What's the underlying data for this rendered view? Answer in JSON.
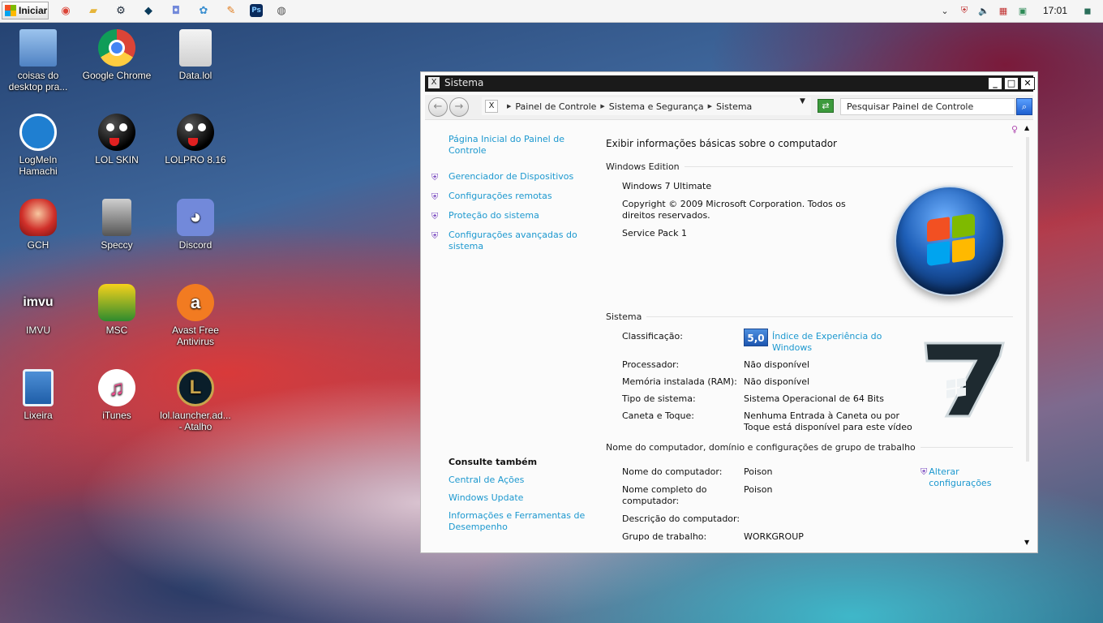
{
  "taskbar": {
    "start_label": "Iniciar",
    "pinned": [
      {
        "name": "chrome-icon",
        "glyph": "◉",
        "color": "#db4437"
      },
      {
        "name": "folder-icon",
        "glyph": "▰",
        "color": "#e6b53a"
      },
      {
        "name": "steam-icon",
        "glyph": "⚙",
        "color": "#1b2838"
      },
      {
        "name": "league-icon",
        "glyph": "◆",
        "color": "#0a3a5a"
      },
      {
        "name": "discord-icon",
        "glyph": "◘",
        "color": "#7289da"
      },
      {
        "name": "gallery-icon",
        "glyph": "✿",
        "color": "#3a8fd0"
      },
      {
        "name": "feather-icon",
        "glyph": "✎",
        "color": "#e07a1a"
      },
      {
        "name": "photoshop-icon",
        "glyph": "Ps",
        "color": "#0a2b5c"
      },
      {
        "name": "camera-icon",
        "glyph": "◍",
        "color": "#555555"
      }
    ],
    "clock": "17:01"
  },
  "desktop": {
    "icons": [
      {
        "label": "coisas do desktop pra...",
        "icon": "folder-icon",
        "color": "#5b8fd0"
      },
      {
        "label": "Google Chrome",
        "icon": "chrome-icon",
        "color": "#db4437"
      },
      {
        "label": "Data.lol",
        "icon": "file-icon",
        "color": "#e2e2e2"
      },
      {
        "label": "LogMeIn Hamachi",
        "icon": "hamachi-icon",
        "color": "#1f7fd1"
      },
      {
        "label": "LOL SKIN",
        "icon": "smiley-icon",
        "color": "#111111"
      },
      {
        "label": "LOLPRO 8.16",
        "icon": "smiley-icon",
        "color": "#111111"
      },
      {
        "label": "GCH",
        "icon": "anime-icon",
        "color": "#d0302a"
      },
      {
        "label": "Speccy",
        "icon": "speccy-icon",
        "color": "#777777"
      },
      {
        "label": "Discord",
        "icon": "discord-icon",
        "color": "#7289da"
      },
      {
        "label": "IMVU",
        "icon": "imvu-icon",
        "color": "#222222"
      },
      {
        "label": "MSC",
        "icon": "msc-icon",
        "color": "#2e8b2e"
      },
      {
        "label": "Avast Free Antivirus",
        "icon": "avast-icon",
        "color": "#f27b21"
      },
      {
        "label": "Lixeira",
        "icon": "recycle-bin-icon",
        "color": "#2c6fb8"
      },
      {
        "label": "iTunes",
        "icon": "itunes-icon",
        "color": "#e94b8a"
      },
      {
        "label": "lol.launcher.ad... - Atalho",
        "icon": "league-icon",
        "color": "#c8a44c"
      }
    ]
  },
  "window": {
    "title": "Sistema",
    "breadcrumb": [
      "Painel de Controle",
      "Sistema e Segurança",
      "Sistema"
    ],
    "search_placeholder": "Pesquisar Painel de Controle",
    "leftnav": {
      "home": "Página Inicial do Painel de Controle",
      "links": [
        "Gerenciador de Dispositivos",
        "Configurações remotas",
        "Proteção do sistema",
        "Configurações avançadas do sistema"
      ],
      "see_also_title": "Consulte também",
      "see_also": [
        "Central de Ações",
        "Windows Update",
        "Informações e Ferramentas de Desempenho"
      ]
    },
    "main": {
      "heading": "Exibir informações básicas sobre o computador",
      "edition_section": "Windows Edition",
      "edition": "Windows 7 Ultimate",
      "copyright": "Copyright © 2009 Microsoft Corporation. Todos os direitos reservados.",
      "service_pack": "Service Pack 1",
      "system_section": "Sistema",
      "rating_label": "Classificação:",
      "rating_score": "5,0",
      "rating_link": "Índice de Experiência do Windows",
      "processor_label": "Processador:",
      "processor_value": "Não disponível",
      "ram_label": "Memória instalada (RAM):",
      "ram_value": "Não disponível",
      "type_label": "Tipo de sistema:",
      "type_value": "Sistema Operacional de 64 Bits",
      "pen_label": "Caneta e Toque:",
      "pen_value": "Nenhuma Entrada à Caneta ou por Toque está disponível para este vídeo",
      "name_section": "Nome do computador, domínio e configurações de grupo de trabalho",
      "computer_name_label": "Nome do computador:",
      "computer_name_value": "Poison",
      "full_name_label": "Nome completo do computador:",
      "full_name_value": "Poison",
      "description_label": "Descrição do computador:",
      "workgroup_label": "Grupo de trabalho:",
      "workgroup_value": "WORKGROUP",
      "change_settings": "Alterar configurações"
    }
  }
}
